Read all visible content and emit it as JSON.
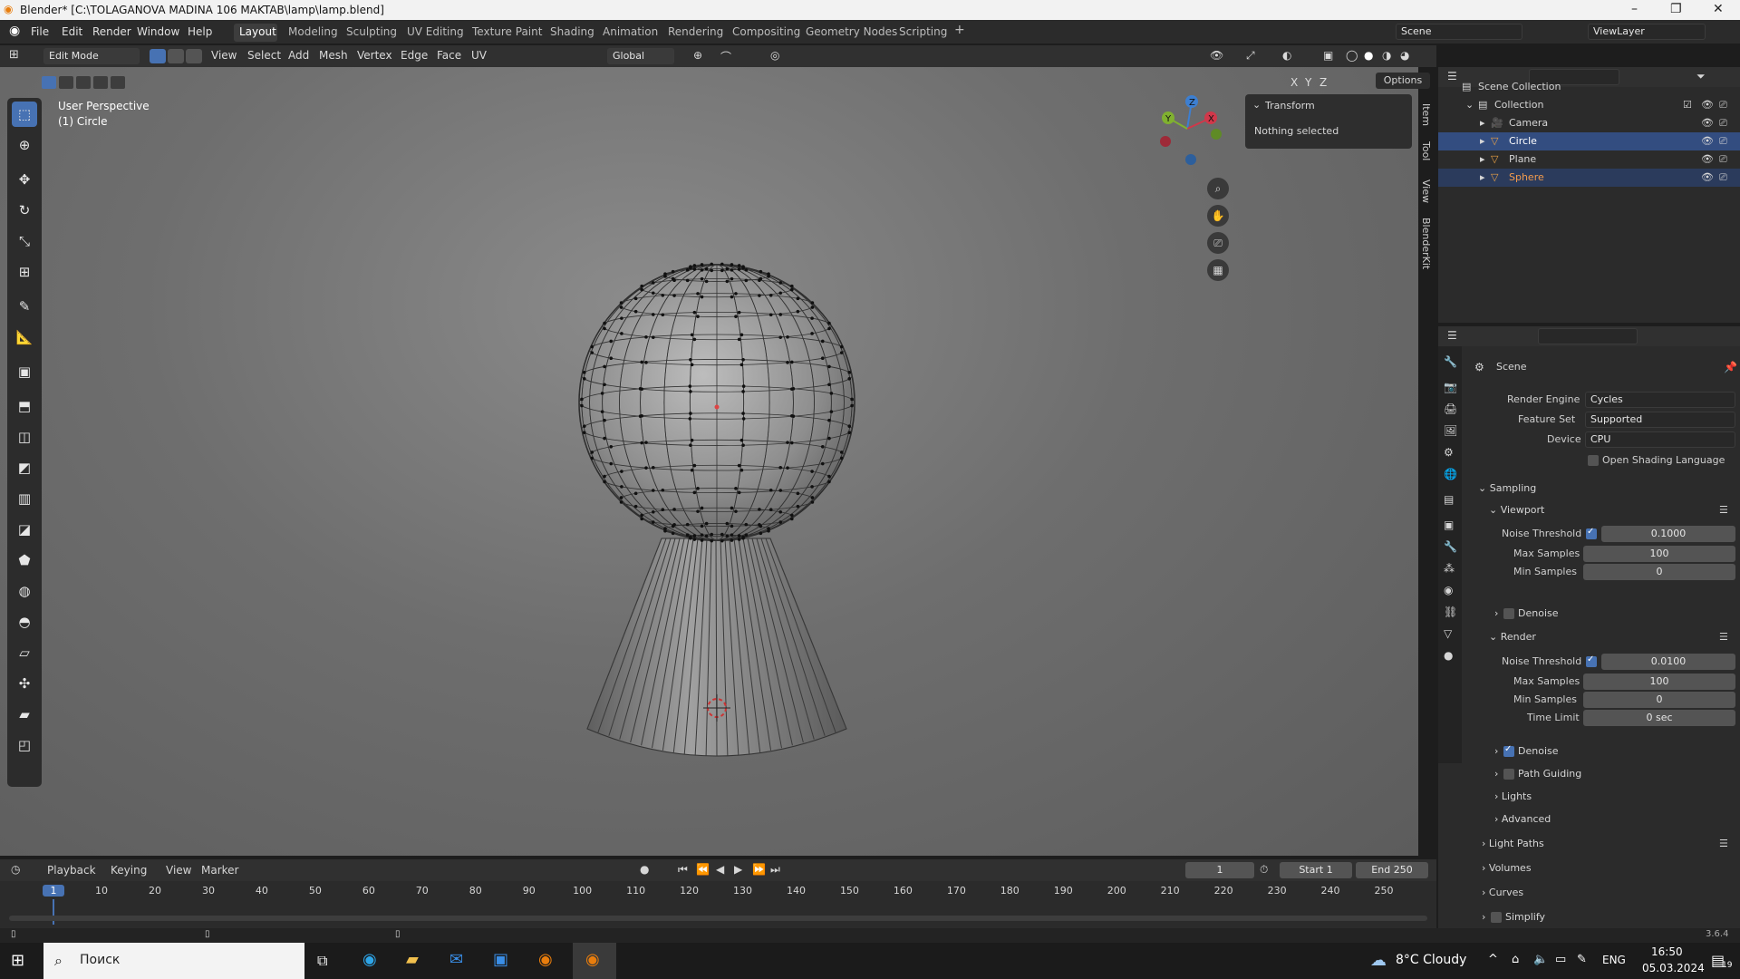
{
  "titlebar": {
    "title": "Blender* [C:\\TOLAGANOVA MADINA 106 MAKTAB\\lamp\\lamp.blend]"
  },
  "menus": [
    "File",
    "Edit",
    "Render",
    "Window",
    "Help"
  ],
  "workspaces": [
    "Layout",
    "Modeling",
    "Sculpting",
    "UV Editing",
    "Texture Paint",
    "Shading",
    "Animation",
    "Rendering",
    "Compositing",
    "Geometry Nodes",
    "Scripting",
    "+"
  ],
  "scene_field": "Scene",
  "viewlayer_field": "ViewLayer",
  "header": {
    "mode": "Edit Mode",
    "items": [
      "View",
      "Select",
      "Add",
      "Mesh",
      "Vertex",
      "Edge",
      "Face",
      "UV"
    ],
    "orientation": "Global",
    "options": "Options",
    "axes": [
      "X",
      "Y",
      "Z"
    ]
  },
  "viewport": {
    "perspective": "User Perspective",
    "object": "(1) Circle"
  },
  "npanel": {
    "title": "Transform",
    "message": "Nothing selected",
    "tabs": [
      "Item",
      "Tool",
      "View",
      "BlenderKit"
    ]
  },
  "gizmo": {
    "x": "X",
    "y": "Y",
    "z": "Z"
  },
  "outliner": {
    "root": "Scene Collection",
    "collection": "Collection",
    "items": [
      {
        "name": "Camera"
      },
      {
        "name": "Circle"
      },
      {
        "name": "Plane"
      },
      {
        "name": "Sphere"
      }
    ]
  },
  "props": {
    "header": "Scene",
    "render_engine_label": "Render Engine",
    "render_engine": "Cycles",
    "feature_set_label": "Feature Set",
    "feature_set": "Supported",
    "device_label": "Device",
    "device": "CPU",
    "osl": "Open Shading Language",
    "sampling": "Sampling",
    "viewport": "Viewport",
    "noise_threshold_label": "Noise Threshold",
    "vp_noise": "0.1000",
    "max_samples_label": "Max Samples",
    "vp_max": "100",
    "min_samples_label": "Min Samples",
    "vp_min": "0",
    "denoise": "Denoise",
    "render": "Render",
    "r_noise": "0.0100",
    "r_max": "100",
    "r_min": "0",
    "time_limit_label": "Time Limit",
    "time_limit": "0 sec",
    "path_guiding": "Path Guiding",
    "lights": "Lights",
    "advanced": "Advanced",
    "light_paths": "Light Paths",
    "volumes": "Volumes",
    "curves": "Curves",
    "simplify": "Simplify"
  },
  "timeline": {
    "menus": [
      "Playback",
      "Keying",
      "View",
      "Marker"
    ],
    "current_frame": "1",
    "start_label": "Start",
    "start": "1",
    "end_label": "End",
    "end": "250",
    "ticks": [
      "1",
      "10",
      "20",
      "30",
      "40",
      "50",
      "60",
      "70",
      "80",
      "90",
      "100",
      "110",
      "120",
      "130",
      "140",
      "150",
      "160",
      "170",
      "180",
      "190",
      "200",
      "210",
      "220",
      "230",
      "240",
      "250"
    ]
  },
  "status": {
    "version": "3.6.4"
  },
  "taskbar": {
    "search": "Поиск",
    "weather": "8°C  Cloudy",
    "lang": "ENG",
    "time": "16:50",
    "date": "05.03.2024",
    "notif": "19"
  }
}
